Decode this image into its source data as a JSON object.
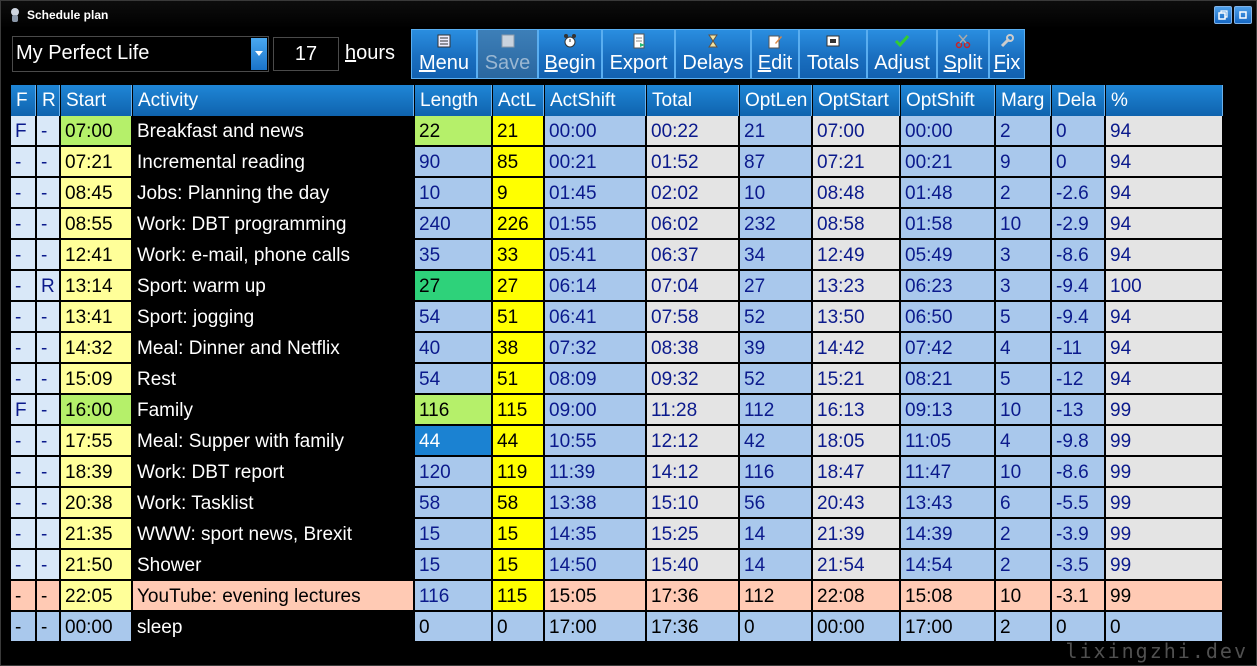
{
  "window": {
    "title": "Schedule plan"
  },
  "toolbar": {
    "plan_name": "My Perfect Life",
    "hours_value": "17",
    "hours_label_mn": "h",
    "hours_label_rest": "ours",
    "buttons": [
      {
        "mn": "M",
        "rest": "enu",
        "icon": "menu-icon"
      },
      {
        "mn": "",
        "rest": "Save",
        "icon": "save-icon"
      },
      {
        "mn": "B",
        "rest": "egin",
        "icon": "alarm-icon"
      },
      {
        "mn": "",
        "rest": "Export",
        "icon": "export-icon"
      },
      {
        "mn": "",
        "rest": "Delays",
        "icon": "hourglass-icon"
      },
      {
        "mn": "E",
        "rest": "dit",
        "icon": "edit-icon"
      },
      {
        "mn": "",
        "rest": "Totals",
        "icon": "totals-icon"
      },
      {
        "mn": "",
        "rest": "Adjust",
        "icon": "check-icon"
      },
      {
        "mn": "S",
        "rest": "plit",
        "icon": "scissors-icon"
      },
      {
        "mn": "F",
        "rest": "ix",
        "icon": "wrench-icon"
      }
    ]
  },
  "grid": {
    "columns": [
      "F",
      "R",
      "Start",
      "Activity",
      "Length",
      "ActL",
      "ActShift",
      "Total",
      "OptLen",
      "OptStart",
      "OptShift",
      "Marg",
      "Dela",
      "%"
    ],
    "rows": [
      {
        "F": "F",
        "R": "-",
        "Start": "07:00",
        "Activity": "Breakfast and news",
        "Length": "22",
        "ActL": "21",
        "ActShift": "00:00",
        "Total": "00:22",
        "OptLen": "21",
        "OptStart": "07:00",
        "OptShift": "00:00",
        "Marg": "2",
        "Dela": "0",
        "Pct": "94",
        "style": "fixed"
      },
      {
        "F": "-",
        "R": "-",
        "Start": "07:21",
        "Activity": "Incremental reading",
        "Length": "90",
        "ActL": "85",
        "ActShift": "00:21",
        "Total": "01:52",
        "OptLen": "87",
        "OptStart": "07:21",
        "OptShift": "00:21",
        "Marg": "9",
        "Dela": "0",
        "Pct": "94",
        "style": "normal"
      },
      {
        "F": "-",
        "R": "-",
        "Start": "08:45",
        "Activity": "Jobs: Planning the day",
        "Length": "10",
        "ActL": "9",
        "ActShift": "01:45",
        "Total": "02:02",
        "OptLen": "10",
        "OptStart": "08:48",
        "OptShift": "01:48",
        "Marg": "2",
        "Dela": "-2.6",
        "Pct": "94",
        "style": "normal"
      },
      {
        "F": "-",
        "R": "-",
        "Start": "08:55",
        "Activity": "Work: DBT programming",
        "Length": "240",
        "ActL": "226",
        "ActShift": "01:55",
        "Total": "06:02",
        "OptLen": "232",
        "OptStart": "08:58",
        "OptShift": "01:58",
        "Marg": "10",
        "Dela": "-2.9",
        "Pct": "94",
        "style": "normal"
      },
      {
        "F": "-",
        "R": "-",
        "Start": "12:41",
        "Activity": "Work: e-mail, phone calls",
        "Length": "35",
        "ActL": "33",
        "ActShift": "05:41",
        "Total": "06:37",
        "OptLen": "34",
        "OptStart": "12:49",
        "OptShift": "05:49",
        "Marg": "3",
        "Dela": "-8.6",
        "Pct": "94",
        "style": "normal"
      },
      {
        "F": "-",
        "R": "R",
        "Start": "13:14",
        "Activity": "Sport: warm up",
        "Length": "27",
        "ActL": "27",
        "ActShift": "06:14",
        "Total": "07:04",
        "OptLen": "27",
        "OptStart": "13:23",
        "OptShift": "06:23",
        "Marg": "3",
        "Dela": "-9.4",
        "Pct": "100",
        "style": "rigid"
      },
      {
        "F": "-",
        "R": "-",
        "Start": "13:41",
        "Activity": "Sport: jogging",
        "Length": "54",
        "ActL": "51",
        "ActShift": "06:41",
        "Total": "07:58",
        "OptLen": "52",
        "OptStart": "13:50",
        "OptShift": "06:50",
        "Marg": "5",
        "Dela": "-9.4",
        "Pct": "94",
        "style": "normal"
      },
      {
        "F": "-",
        "R": "-",
        "Start": "14:32",
        "Activity": "Meal: Dinner and Netflix",
        "Length": "40",
        "ActL": "38",
        "ActShift": "07:32",
        "Total": "08:38",
        "OptLen": "39",
        "OptStart": "14:42",
        "OptShift": "07:42",
        "Marg": "4",
        "Dela": "-11",
        "Pct": "94",
        "style": "normal"
      },
      {
        "F": "-",
        "R": "-",
        "Start": "15:09",
        "Activity": "Rest",
        "Length": "54",
        "ActL": "51",
        "ActShift": "08:09",
        "Total": "09:32",
        "OptLen": "52",
        "OptStart": "15:21",
        "OptShift": "08:21",
        "Marg": "5",
        "Dela": "-12",
        "Pct": "94",
        "style": "normal"
      },
      {
        "F": "F",
        "R": "-",
        "Start": "16:00",
        "Activity": "Family",
        "Length": "116",
        "ActL": "115",
        "ActShift": "09:00",
        "Total": "11:28",
        "OptLen": "112",
        "OptStart": "16:13",
        "OptShift": "09:13",
        "Marg": "10",
        "Dela": "-13",
        "Pct": "99",
        "style": "fixed"
      },
      {
        "F": "-",
        "R": "-",
        "Start": "17:55",
        "Activity": "Meal: Supper with family",
        "Length": "44",
        "ActL": "44",
        "ActShift": "10:55",
        "Total": "12:12",
        "OptLen": "42",
        "OptStart": "18:05",
        "OptShift": "11:05",
        "Marg": "4",
        "Dela": "-9.8",
        "Pct": "99",
        "style": "selected"
      },
      {
        "F": "-",
        "R": "-",
        "Start": "18:39",
        "Activity": "Work: DBT report",
        "Length": "120",
        "ActL": "119",
        "ActShift": "11:39",
        "Total": "14:12",
        "OptLen": "116",
        "OptStart": "18:47",
        "OptShift": "11:47",
        "Marg": "10",
        "Dela": "-8.6",
        "Pct": "99",
        "style": "normal"
      },
      {
        "F": "-",
        "R": "-",
        "Start": "20:38",
        "Activity": "Work: Tasklist",
        "Length": "58",
        "ActL": "58",
        "ActShift": "13:38",
        "Total": "15:10",
        "OptLen": "56",
        "OptStart": "20:43",
        "OptShift": "13:43",
        "Marg": "6",
        "Dela": "-5.5",
        "Pct": "99",
        "style": "normal"
      },
      {
        "F": "-",
        "R": "-",
        "Start": "21:35",
        "Activity": "WWW: sport news, Brexit",
        "Length": "15",
        "ActL": "15",
        "ActShift": "14:35",
        "Total": "15:25",
        "OptLen": "14",
        "OptStart": "21:39",
        "OptShift": "14:39",
        "Marg": "2",
        "Dela": "-3.9",
        "Pct": "99",
        "style": "normal"
      },
      {
        "F": "-",
        "R": "-",
        "Start": "21:50",
        "Activity": "Shower",
        "Length": "15",
        "ActL": "15",
        "ActShift": "14:50",
        "Total": "15:40",
        "OptLen": "14",
        "OptStart": "21:54",
        "OptShift": "14:54",
        "Marg": "2",
        "Dela": "-3.5",
        "Pct": "99",
        "style": "normal"
      },
      {
        "F": "-",
        "R": "-",
        "Start": "22:05",
        "Activity": "YouTube: evening lectures",
        "Length": "116",
        "ActL": "115",
        "ActShift": "15:05",
        "Total": "17:36",
        "OptLen": "112",
        "OptStart": "22:08",
        "OptShift": "15:08",
        "Marg": "10",
        "Dela": "-3.1",
        "Pct": "99",
        "style": "peach"
      },
      {
        "F": "-",
        "R": "-",
        "Start": "00:00",
        "Activity": "sleep",
        "Length": "0",
        "ActL": "0",
        "ActShift": "17:00",
        "Total": "17:36",
        "OptLen": "0",
        "OptStart": "00:00",
        "OptShift": "17:00",
        "Marg": "2",
        "Dela": "0",
        "Pct": "0",
        "style": "end"
      }
    ]
  },
  "watermark": "lixingzhi.dev"
}
